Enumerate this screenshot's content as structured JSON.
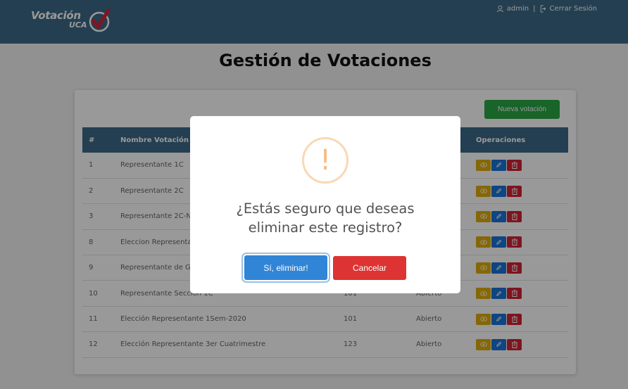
{
  "header": {
    "logo_line1": "Votación",
    "logo_line2": "UCA",
    "username": "admin",
    "separator": "|",
    "logout_label": "Cerrar Sesión"
  },
  "page": {
    "title": "Gestión de Votaciones",
    "new_button_label": "Nueva votación"
  },
  "table": {
    "headers": [
      "#",
      "Nombre Votación",
      "",
      "",
      "Operaciones"
    ],
    "rows": [
      {
        "id": "1",
        "name": "Representante 1C",
        "col3": "",
        "col4": ""
      },
      {
        "id": "2",
        "name": "Representante 2C",
        "col3": "",
        "col4": ""
      },
      {
        "id": "3",
        "name": "Representante 2C-N",
        "col3": "",
        "col4": ""
      },
      {
        "id": "8",
        "name": "Eleccion Representa",
        "col3": "",
        "col4": ""
      },
      {
        "id": "9",
        "name": "Representante de Gr",
        "col3": "",
        "col4": ""
      },
      {
        "id": "10",
        "name": "Representante Seccion 1C",
        "col3": "101",
        "col4": "Abierto"
      },
      {
        "id": "11",
        "name": "Elección Representante 1Sem-2020",
        "col3": "101",
        "col4": "Abierto"
      },
      {
        "id": "12",
        "name": "Elección Representante 3er Cuatrimestre",
        "col3": "123",
        "col4": "Abierto"
      }
    ]
  },
  "dialog": {
    "icon_symbol": "!",
    "message_line1": "¿Estás seguro que deseas",
    "message_line2": "eliminar este registro?",
    "confirm_label": "Sí, eliminar!",
    "cancel_label": "Cancelar"
  },
  "colors": {
    "header_bg": "#3d6a87",
    "success": "#28a745",
    "view_btn": "#e0ac0e",
    "edit_btn": "#1a74d6",
    "delete_btn": "#cf2434",
    "confirm_btn": "#3085d6",
    "cancel_btn": "#dd3333",
    "warning": "#f8bb86"
  }
}
